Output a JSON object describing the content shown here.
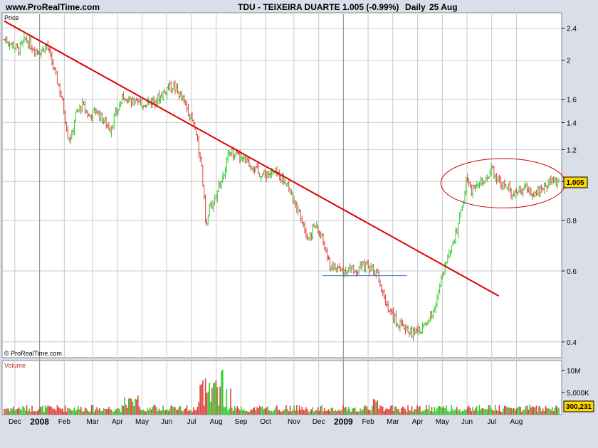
{
  "header": {
    "site": "www.ProRealTime.com",
    "symbol_title": "TDU - TEIXEIRA DUARTE",
    "quote": "1.005 (-0.99%)",
    "period": "Daily",
    "date": "25 Aug"
  },
  "price_panel": {
    "label": "Price",
    "watermark": "© ProRealTime.com",
    "last_value_label": "1.005"
  },
  "volume_panel": {
    "label": "Volume",
    "last_value_label": "300,231"
  },
  "colors": {
    "up": "#2ecc2e",
    "down": "#e04040",
    "trendline": "#dd0000",
    "support": "#3a6fd8",
    "ellipse": "#cc0000",
    "grid": "#c8c8c8",
    "background": "#ffffff"
  },
  "chart_data": [
    {
      "type": "line",
      "name": "price",
      "title": "TDU - TEIXEIRA DUARTE",
      "scale": "log",
      "y_ticks": [
        "2.4",
        "2",
        "1.6",
        "1.4",
        "1.2",
        "1",
        "0.8",
        "0.6",
        "0.4"
      ],
      "x_ticks": [
        "Dec",
        "2008",
        "Feb",
        "Mar",
        "Apr",
        "May",
        "Jun",
        "Jul",
        "Aug",
        "Sep",
        "Oct",
        "Nov",
        "Dec",
        "2009",
        "Feb",
        "Mar",
        "Apr",
        "May",
        "Jun",
        "Jul",
        "Aug"
      ],
      "series": [
        {
          "closes": [
            [
              0,
              2.25
            ],
            [
              2,
              2.2
            ],
            [
              4,
              2.12
            ],
            [
              6,
              2.25
            ],
            [
              8,
              2.15
            ],
            [
              10,
              2.1
            ],
            [
              12,
              2.18
            ],
            [
              14,
              1.9
            ],
            [
              16,
              1.65
            ],
            [
              18,
              1.3
            ],
            [
              19,
              1.28
            ],
            [
              20,
              1.45
            ],
            [
              22,
              1.55
            ],
            [
              24,
              1.45
            ],
            [
              26,
              1.5
            ],
            [
              28,
              1.42
            ],
            [
              30,
              1.35
            ],
            [
              32,
              1.5
            ],
            [
              34,
              1.65
            ],
            [
              36,
              1.58
            ],
            [
              38,
              1.55
            ],
            [
              40,
              1.57
            ],
            [
              42,
              1.58
            ],
            [
              44,
              1.62
            ],
            [
              46,
              1.7
            ],
            [
              48,
              1.72
            ],
            [
              50,
              1.62
            ],
            [
              52,
              1.5
            ],
            [
              54,
              1.35
            ],
            [
              56,
              1.05
            ],
            [
              57,
              0.78
            ],
            [
              58,
              0.85
            ],
            [
              60,
              0.92
            ],
            [
              62,
              1.05
            ],
            [
              64,
              1.2
            ],
            [
              66,
              1.15
            ],
            [
              68,
              1.12
            ],
            [
              70,
              1.1
            ],
            [
              72,
              1.05
            ],
            [
              74,
              1.04
            ],
            [
              76,
              1.05
            ],
            [
              78,
              1.03
            ],
            [
              80,
              1.0
            ],
            [
              82,
              0.88
            ],
            [
              84,
              0.82
            ],
            [
              86,
              0.72
            ],
            [
              88,
              0.78
            ],
            [
              90,
              0.72
            ],
            [
              92,
              0.62
            ],
            [
              94,
              0.61
            ],
            [
              96,
              0.6
            ],
            [
              98,
              0.61
            ],
            [
              100,
              0.6
            ],
            [
              102,
              0.62
            ],
            [
              104,
              0.61
            ],
            [
              106,
              0.58
            ],
            [
              108,
              0.5
            ],
            [
              110,
              0.46
            ],
            [
              112,
              0.44
            ],
            [
              114,
              0.43
            ],
            [
              116,
              0.42
            ],
            [
              118,
              0.43
            ],
            [
              120,
              0.45
            ],
            [
              122,
              0.5
            ],
            [
              124,
              0.58
            ],
            [
              126,
              0.68
            ],
            [
              128,
              0.75
            ],
            [
              130,
              0.9
            ],
            [
              131,
              1.05
            ],
            [
              132,
              0.95
            ],
            [
              134,
              1.0
            ],
            [
              136,
              0.98
            ],
            [
              138,
              1.08
            ],
            [
              140,
              1.0
            ],
            [
              142,
              0.97
            ],
            [
              144,
              0.94
            ],
            [
              146,
              0.95
            ],
            [
              148,
              0.96
            ],
            [
              150,
              0.94
            ],
            [
              152,
              0.96
            ],
            [
              154,
              0.99
            ],
            [
              156,
              1.0
            ],
            [
              157,
              1.005
            ]
          ]
        }
      ],
      "trendline": {
        "from": [
          0,
          2.5
        ],
        "to": [
          140,
          0.52
        ]
      },
      "support_line": {
        "from": [
          90,
          0.584
        ],
        "to": [
          114,
          0.584
        ],
        "value": 0.584
      },
      "highlighted_range": [
        "May",
        "Aug"
      ]
    },
    {
      "type": "bar",
      "name": "volume",
      "y_ticks": [
        "10M",
        "5,000K"
      ],
      "last_value": 300231
    }
  ]
}
